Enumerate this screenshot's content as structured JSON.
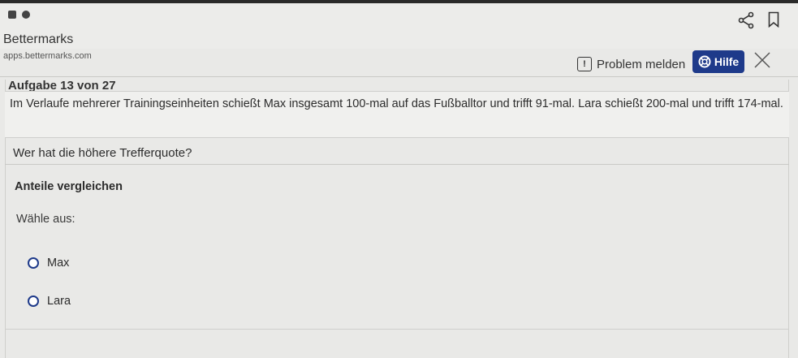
{
  "browser": {
    "title": "Bettermarks",
    "url": "apps.bettermarks.com"
  },
  "header": {
    "task_counter": "Aufgabe 13 von 27",
    "report_label": "Problem melden",
    "help_label": "Hilfe"
  },
  "task": {
    "question": "Im Verlaufe mehrerer Trainingseinheiten schießt Max insgesamt 100-mal auf das Fußballtor und trifft 91-mal. Lara schießt 200-mal und trifft 174-mal.",
    "subquestion": "Wer hat die höhere Trefferquote?",
    "section_heading": "Anteile vergleichen",
    "prompt": "Wähle aus:",
    "options": [
      {
        "label": "Max"
      },
      {
        "label": "Lara"
      }
    ]
  },
  "colors": {
    "accent": "#1e3a8a",
    "background": "#e9e9e7"
  }
}
